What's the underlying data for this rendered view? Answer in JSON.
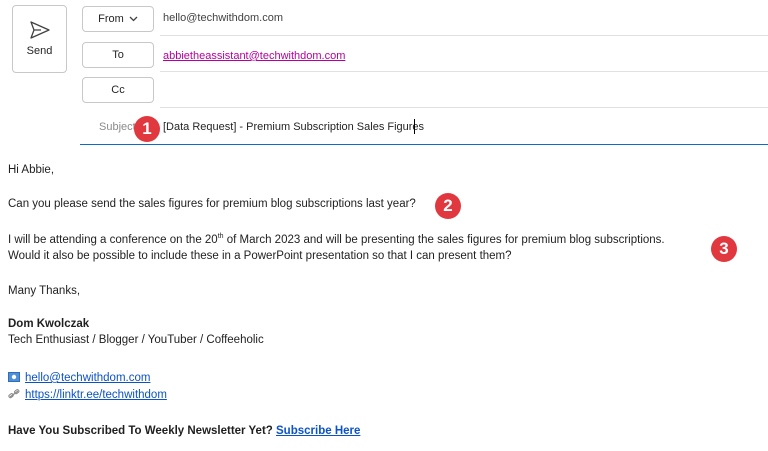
{
  "compose": {
    "send_label": "Send",
    "from_label": "From",
    "from_value": "hello@techwithdom.com",
    "to_label": "To",
    "to_value": "abbietheassistant@techwithdom.com",
    "cc_label": "Cc",
    "subject_label": "Subject",
    "subject_value": "[Data Request] - Premium Subscription Sales Figures"
  },
  "badges": [
    "1",
    "2",
    "3"
  ],
  "body": {
    "greeting": "Hi Abbie,",
    "line1": "Can you please send the sales figures for premium blog subscriptions last year?",
    "line2_pre": "I will be attending a conference on the 20",
    "line2_sup": "th",
    "line2_post": " of March 2023 and will be presenting the sales figures for premium blog subscriptions.",
    "line3": "Would it also be possible to include these in a PowerPoint presentation so that I can present them?",
    "closing": "Many Thanks,",
    "sig_name": "Dom Kwolczak",
    "sig_title": "Tech Enthusiast / Blogger / YouTuber / Coffeeholic",
    "email_link": "hello@techwithdom.com",
    "linktree": "https://linktr.ee/techwithdom",
    "newsletter_text": "Have You Subscribed To Weekly Newsletter Yet?",
    "subscribe_link": "Subscribe Here"
  },
  "colors": {
    "badge": "#e0383e",
    "link": "#0b52c7",
    "to_value": "#b4009e",
    "focus_line": "#0f6cbd"
  }
}
